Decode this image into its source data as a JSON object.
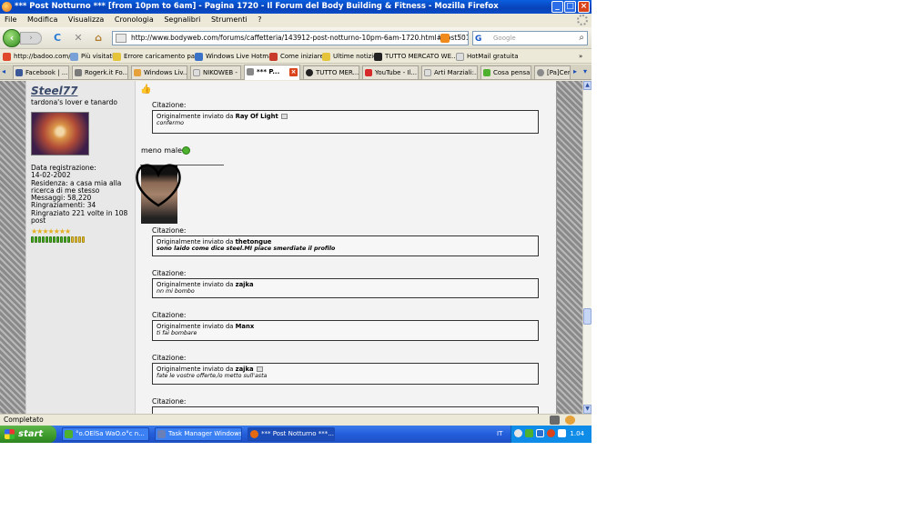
{
  "window": {
    "title": "*** Post Notturno *** [from 10pm to 6am] - Pagina 1720 - Il Forum del Body Building & Fitness - Mozilla Firefox",
    "minimize": "_",
    "maximize": "□",
    "close": "×"
  },
  "menu": [
    "File",
    "Modifica",
    "Visualizza",
    "Cronologia",
    "Segnalibri",
    "Strumenti",
    "?"
  ],
  "nav": {
    "back": "‹",
    "forward": "›",
    "reload": "C",
    "stop": "✕",
    "home": "⌂",
    "url": "http://www.bodyweb.com/forums/caffetteria/143912-post-notturno-10pm-6am-1720.html#post5017070",
    "search_engine": "G",
    "search_placeholder": "Google"
  },
  "bookmarks": [
    {
      "label": "http://badoo.com/",
      "color": "#e0482c"
    },
    {
      "label": "Più visitati",
      "color": "#7aa0d8"
    },
    {
      "label": "Errore caricamento pa...",
      "color": "#e6c43a"
    },
    {
      "label": "Windows Live Hotmail",
      "color": "#3a72c8"
    },
    {
      "label": "Come iniziare",
      "color": "#c83a2a"
    },
    {
      "label": "Ultime notizie",
      "color": "#e6c43a"
    },
    {
      "label": "TUTTO MERCATO WE...",
      "color": "#222222"
    },
    {
      "label": "HotMail gratuita",
      "color": "#dddddd"
    }
  ],
  "bookmarks_more": "»",
  "tabs": [
    {
      "label": "Facebook | ...",
      "color": "#3b5998"
    },
    {
      "label": "Rogerk.it Fo...",
      "color": "#7a7a7a"
    },
    {
      "label": "Windows Liv...",
      "color": "#e6a23a"
    },
    {
      "label": "NIKOWEB -",
      "color": "#dddddd"
    },
    {
      "label": "*** P...",
      "color": "#888888",
      "active": true
    },
    {
      "label": "TUTTO MER...",
      "color": "#222222"
    },
    {
      "label": "YouTube - Il...",
      "color": "#d62a2a"
    },
    {
      "label": "Arti Marziali:...",
      "color": "#dddddd"
    },
    {
      "label": "Cosa pensa...",
      "color": "#4eb02f"
    },
    {
      "label": "[Pa]Cer",
      "color": "#8a8a8a"
    }
  ],
  "tab_close": "×",
  "tab_scroll_left": "◂",
  "tab_scroll_right": "▸",
  "tab_list": "▾",
  "user": {
    "name": "Steel77",
    "title": "tardona's lover e tanardo",
    "info": [
      "Data registrazione:",
      "14-02-2002",
      "Residenza: a casa mia alla",
      "ricerca di me stesso",
      "Messaggi: 58,220",
      "Ringraziamenti: 34",
      "Ringraziato 221 volte in 108",
      "post"
    ],
    "stars": "★★★★★★★"
  },
  "post": {
    "thumb_icon": "👍",
    "quote_label": "Citazione:",
    "quote_prefix": "Originalmente inviato da",
    "quotes": [
      {
        "author": "Ray Of Light",
        "text": "confermo",
        "bold": false
      },
      {
        "author": "thetongue",
        "text": "sono laido come dice steel.MI piace smerdiate il profilo",
        "bold": true
      },
      {
        "author": "zajka",
        "text": "nn mi bombo",
        "bold": false
      },
      {
        "author": "Manx",
        "text": "ti fai bombare",
        "bold": false
      },
      {
        "author": "zajka",
        "text": "fate le vostre offerte,lo metto sull'asta",
        "bold": false
      }
    ],
    "comment": "meno male"
  },
  "scroll": {
    "up": "▲",
    "down": "▼"
  },
  "status": {
    "text": "Completato"
  },
  "taskbar": {
    "start": "start",
    "tasks": [
      {
        "label": "°o.OElSa WaO.o°c n...",
        "color": "#4eb02f"
      },
      {
        "label": "Task Manager Windows",
        "color": "#6a7fb8"
      },
      {
        "label": "*** Post Notturno ***...",
        "color": "#e46a12",
        "active": true
      }
    ],
    "language": "IT",
    "clock": "1.04"
  },
  "colors": {
    "title_bar": "#0842b8",
    "taskbar": "#245edb",
    "start": "#3c9a2b",
    "page_bg": "#f3f3f3",
    "forum_border": "#9b9b9b"
  }
}
